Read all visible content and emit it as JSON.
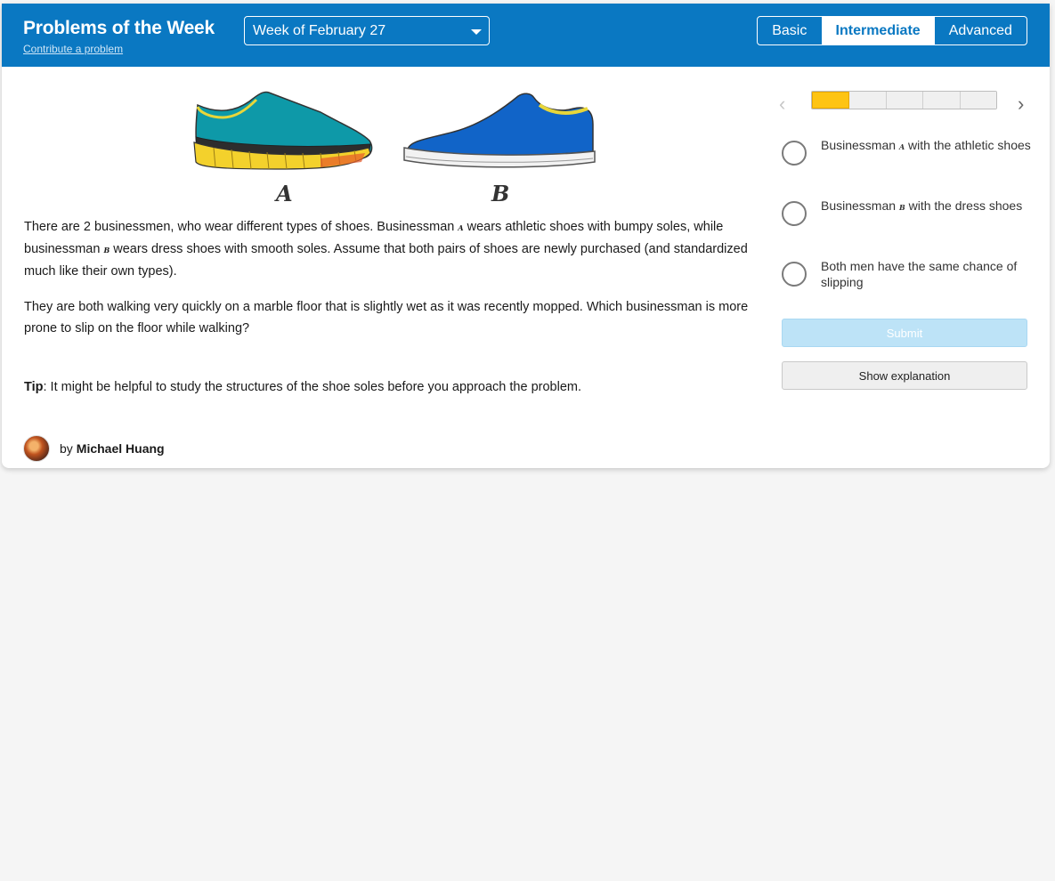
{
  "header": {
    "title": "Problems of the Week",
    "contribute_link": "Contribute a problem",
    "week_selected": "Week of February 27",
    "levels": [
      "Basic",
      "Intermediate",
      "Advanced"
    ],
    "active_level": "Intermediate"
  },
  "problem": {
    "image_labels": {
      "a": "A",
      "b": "B"
    },
    "p1_part1": "There are 2 businessmen, who wear different types of shoes. Businessman ",
    "p1_letter_a": "A",
    "p1_part2": " wears athletic shoes with bumpy soles, while businessman ",
    "p1_letter_b": "B",
    "p1_part3": " wears dress shoes with smooth soles. Assume that both pairs of shoes are newly purchased (and standardized much like their own types).",
    "p2": "They are both walking very quickly on a marble floor that is slightly wet as it was recently mopped. Which businessman is more prone to slip on the floor while walking?",
    "tip_label": "Tip",
    "tip_text": ": It might be helpful to study the structures of the shoe soles before you approach the problem."
  },
  "author": {
    "prefix": "by",
    "name": "Michael Huang"
  },
  "progress": {
    "total": 5,
    "current": 1
  },
  "answers": {
    "opt1_pre": "Businessman ",
    "opt1_letter": "A",
    "opt1_post": " with the athletic shoes",
    "opt2_pre": "Businessman ",
    "opt2_letter": "B",
    "opt2_post": " with the dress shoes",
    "opt3": "Both men have the same chance of slipping"
  },
  "buttons": {
    "submit": "Submit",
    "show_explanation": "Show explanation"
  },
  "colors": {
    "header": "#0a78c2",
    "progress_active": "#fec413",
    "submit_disabled": "#bde3f7"
  }
}
